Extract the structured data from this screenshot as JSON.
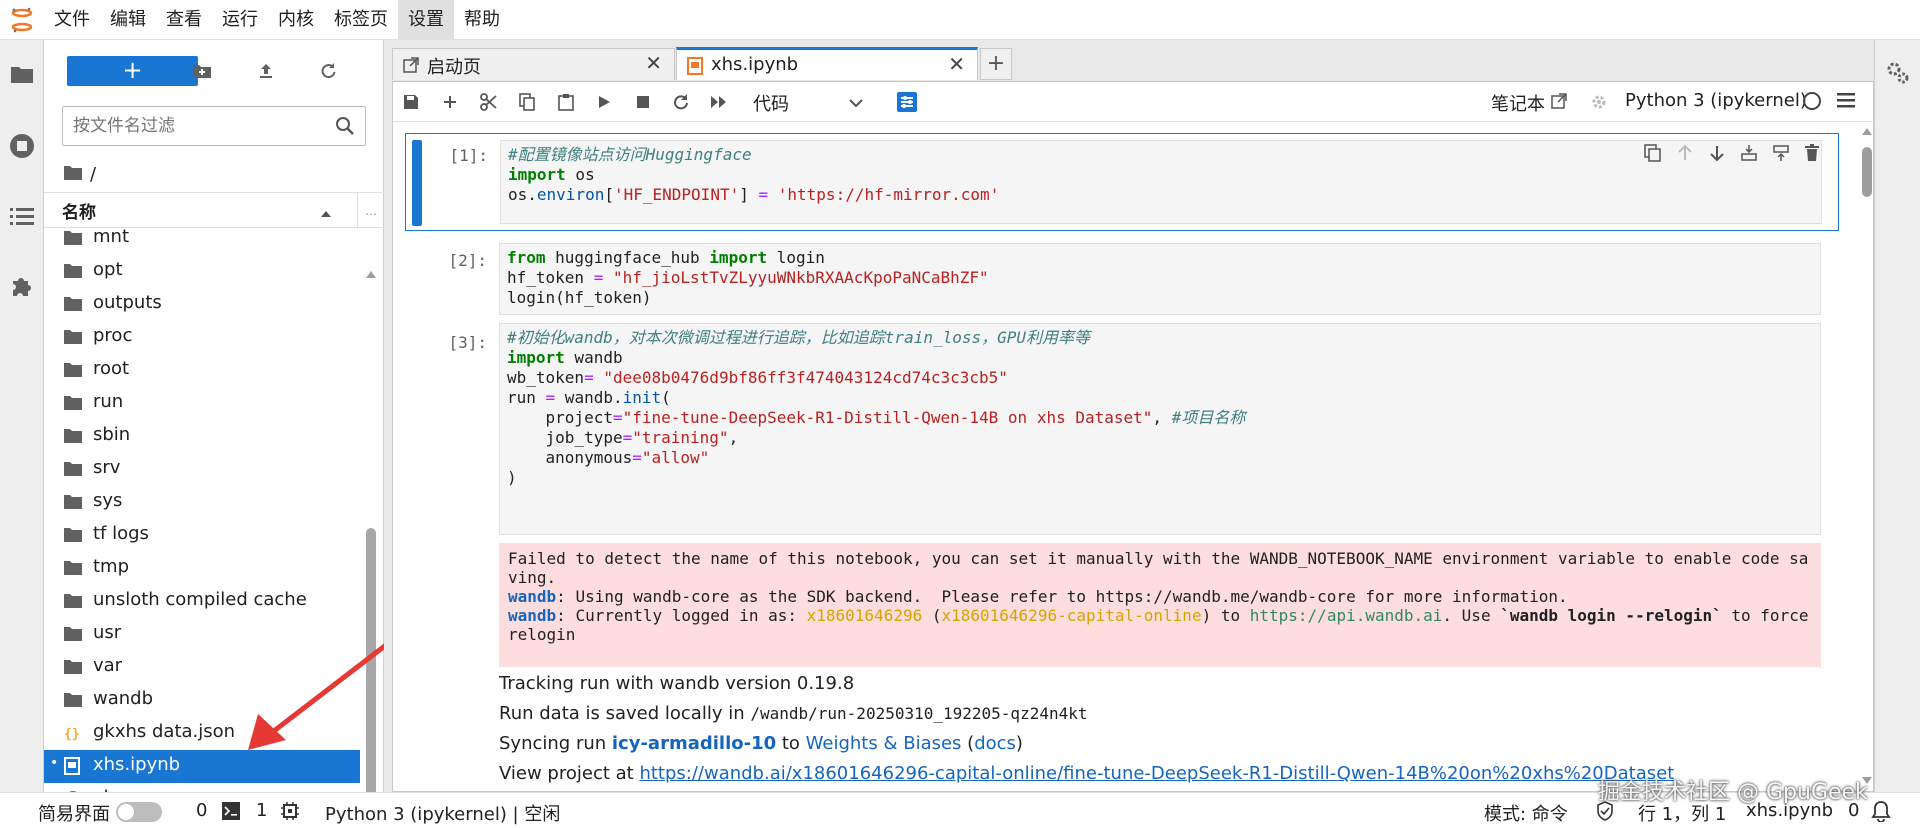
{
  "menubar": {
    "items": [
      "文件",
      "编辑",
      "查看",
      "运行",
      "内核",
      "标签页",
      "设置",
      "帮助"
    ],
    "active_index": 6
  },
  "filebrowser": {
    "new_label": "+",
    "filter_placeholder": "按文件名过滤",
    "breadcrumb": "/",
    "column_name": "名称",
    "items": [
      {
        "name": "mnt",
        "type": "folder"
      },
      {
        "name": "opt",
        "type": "folder"
      },
      {
        "name": "outputs",
        "type": "folder"
      },
      {
        "name": "proc",
        "type": "folder"
      },
      {
        "name": "root",
        "type": "folder"
      },
      {
        "name": "run",
        "type": "folder"
      },
      {
        "name": "sbin",
        "type": "folder"
      },
      {
        "name": "srv",
        "type": "folder"
      },
      {
        "name": "sys",
        "type": "folder"
      },
      {
        "name": "tf logs",
        "type": "folder"
      },
      {
        "name": "tmp",
        "type": "folder"
      },
      {
        "name": "unsloth compiled cache",
        "type": "folder"
      },
      {
        "name": "usr",
        "type": "folder"
      },
      {
        "name": "var",
        "type": "folder"
      },
      {
        "name": "wandb",
        "type": "folder"
      },
      {
        "name": "gkxhs data.json",
        "type": "json"
      },
      {
        "name": "xhs.ipynb",
        "type": "notebook",
        "selected": true,
        "running_dot": "•"
      },
      {
        "name": "xhs.py",
        "type": "python"
      }
    ]
  },
  "tabs": [
    {
      "label": "启动页",
      "close": "✕"
    },
    {
      "label": "xhs.ipynb",
      "close": "✕",
      "active": true
    }
  ],
  "tab_add": "+",
  "toolbar": {
    "cell_type": "代码",
    "notebook_label": "笔记本",
    "kernel_name": "Python 3 (ipykernel)"
  },
  "cells": {
    "c1": {
      "prompt": "[1]:",
      "comment": "#配置镜像站点访问Huggingface",
      "kw_import": "import",
      "mod": " os",
      "l3a": "os.",
      "l3b": "environ",
      "l3c": "[",
      "l3d": "'HF_ENDPOINT'",
      "l3e": "] ",
      "l3f": "=",
      "l3g": " ",
      "l3h": "'https://hf-mirror.com'"
    },
    "c2": {
      "prompt": "[2]:",
      "kw_from": "from",
      "mod": " huggingface_hub ",
      "kw_import": "import",
      "name": " login",
      "l2a": "hf_token ",
      "l2b": "=",
      "l2c": " ",
      "l2d": "\"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\"",
      "l3": "login(hf_token)"
    },
    "c3": {
      "prompt": "[3]:",
      "comment": "#初始化wandb，对本次微调过程进行追踪，比如追踪train_loss，GPU利用率等",
      "kw_import": "import",
      "mod": " wandb",
      "l3a": "wb_token",
      "l3b": "=",
      "l3c": " ",
      "l3d": "\"dee08b0476d9bf86ff3f474043124cd74c3c3cb5\"",
      "l4a": "run ",
      "l4b": "=",
      "l4c": " wandb.",
      "l4d": "init",
      "l4e": "(",
      "l5a": "    project",
      "l5b": "=",
      "l5c": "\"fine-tune-DeepSeek-R1-Distill-Qwen-14B on xhs Dataset\"",
      "l5d": ", ",
      "l5e": "#项目名称",
      "l6a": "    job_type",
      "l6b": "=",
      "l6c": "\"training\"",
      "l6d": ",",
      "l7a": "    anonymous",
      "l7b": "=",
      "l7c": "\"allow\"",
      "l8": ")",
      "stderr": {
        "line1": "Failed to detect the name of this notebook, you can set it manually with the WANDB_NOTEBOOK_NAME environment variable to enable code saving.",
        "l2a": "wandb",
        "l2b": ": Using wandb-core as the SDK backend.  Please refer to https://wandb.me/wandb-core for more information.",
        "l3a": "wandb",
        "l3b": ": Currently logged in as: ",
        "l3c": "x18601646296",
        "l3d": " (",
        "l3e": "x18601646296-capital-online",
        "l3f": ") to ",
        "l3g": "https://api.wandb.ai",
        "l3h": ". Use ",
        "l3i": "`wandb login --relogin`",
        "l3j": " to force relogin"
      },
      "out1": "Tracking run with wandb version 0.19.8",
      "out2a": "Run data is saved locally in ",
      "out2b": "/wandb/run-20250310_192205-qz24n4kt",
      "out3a": "Syncing run ",
      "out3b": "icy-armadillo-10",
      "out3c": " to ",
      "out3d": "Weights & Biases",
      "out3e": " (",
      "out3f": "docs",
      "out3g": ")",
      "out4a": "View project at ",
      "out4b": "https://wandb.ai/x18601646296-capital-online/fine-tune-DeepSeek-R1-Distill-Qwen-14B%20on%20xhs%20Dataset"
    }
  },
  "statusbar": {
    "simple_label": "简易界面",
    "terminals": "0",
    "kernels": "1",
    "kernel_status": "Python 3 (ipykernel) | 空闲",
    "mode": "模式: 命令",
    "position": "行 1，列 1",
    "filename": "xhs.ipynb",
    "notifications": "0"
  },
  "watermark": "掘金技术社区 @ GpuGeek",
  "colors": {
    "accent": "#1976d2",
    "stderr_bg": "#fddddd",
    "arrow": "#e53935"
  }
}
